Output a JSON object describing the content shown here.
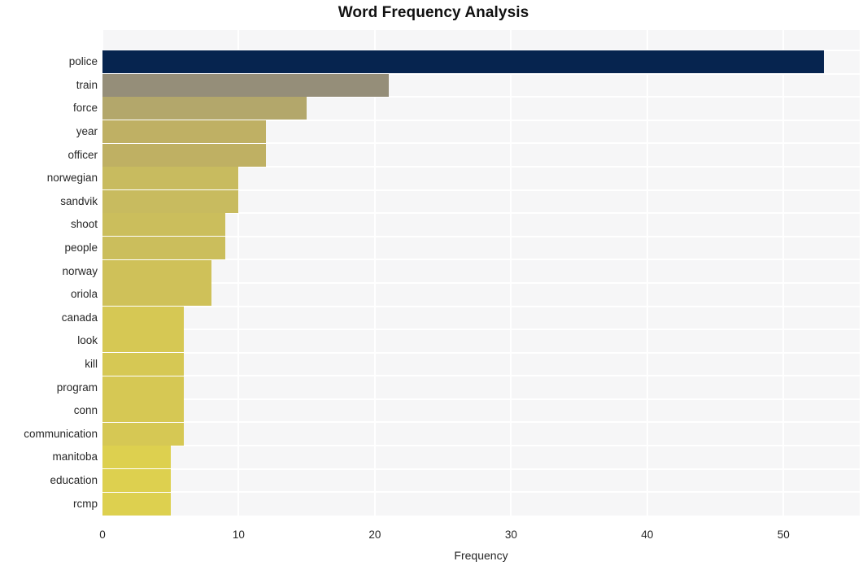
{
  "chart_data": {
    "type": "bar",
    "orientation": "horizontal",
    "title": "Word Frequency Analysis",
    "xlabel": "Frequency",
    "ylabel": "",
    "xlim": [
      0,
      55.6
    ],
    "xticks": [
      0,
      10,
      20,
      30,
      40,
      50
    ],
    "xtick_labels": [
      "0",
      "10",
      "20",
      "30",
      "40",
      "50"
    ],
    "grid": true,
    "grid_axis": "both",
    "grid_color": "#ffffff",
    "plot_background": "#f6f6f7",
    "figure_background": "#ffffff",
    "legend": null,
    "categories": [
      "police",
      "train",
      "force",
      "year",
      "officer",
      "norwegian",
      "sandvik",
      "shoot",
      "people",
      "norway",
      "oriola",
      "canada",
      "look",
      "kill",
      "program",
      "conn",
      "communication",
      "manitoba",
      "education",
      "rcmp"
    ],
    "values": [
      53,
      21,
      15,
      12,
      12,
      10,
      10,
      9,
      9,
      8,
      8,
      6,
      6,
      6,
      6,
      6,
      6,
      5,
      5,
      5
    ],
    "bar_colors": [
      "#06244f",
      "#958e79",
      "#b3a76b",
      "#bfb064",
      "#bfb063",
      "#c8bb5f",
      "#c8bb5f",
      "#cbbe5c",
      "#cbbe5c",
      "#cfc159",
      "#cfc159",
      "#d6c854",
      "#d6c854",
      "#d6c854",
      "#d6c854",
      "#d6c854",
      "#d6c854",
      "#ddd04f",
      "#ddd04f",
      "#ddd04f"
    ],
    "colormap_note": "sequential navy-to-gold, darker = higher frequency"
  },
  "axis_title": {
    "x": "Frequency"
  }
}
